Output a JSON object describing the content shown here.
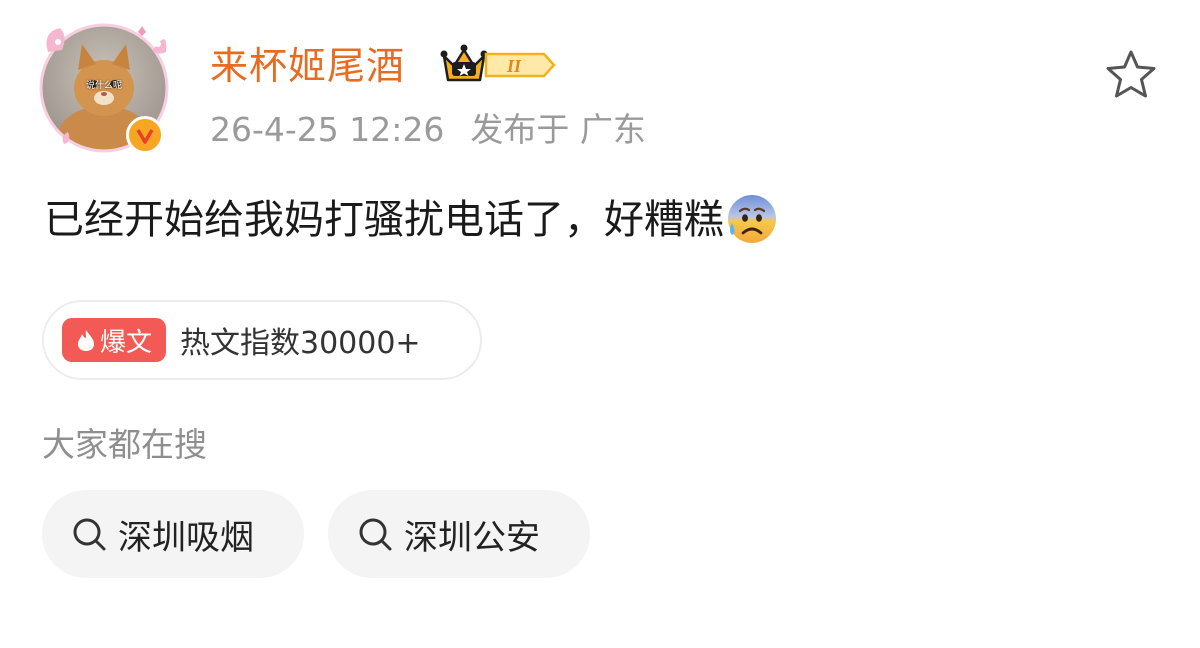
{
  "post": {
    "username": "来杯姬尾酒",
    "avatar_caption": "说什么呢",
    "time": "26-4-25 12:26",
    "location": "发布于 广东",
    "text": "已经开始给我妈打骚扰电话了，好糟糕",
    "vip_level": "II",
    "verified_letter": "V"
  },
  "hot": {
    "label": "爆文",
    "index_text": "热文指数30000+"
  },
  "searches": {
    "heading": "大家都在搜",
    "items": [
      {
        "label": "深圳吸烟"
      },
      {
        "label": "深圳公安"
      }
    ]
  },
  "icons": {
    "star": "star-icon",
    "search": "search-icon",
    "emoji": "anxious-face-with-sweat-emoji",
    "crown": "crown-icon",
    "flame": "flame-icon"
  },
  "colors": {
    "username": "#e86b1f",
    "meta": "#9a9a9a",
    "hot_label_bg": "#f35a55",
    "chip_bg": "#f4f4f4",
    "verified": "#f6a623"
  }
}
